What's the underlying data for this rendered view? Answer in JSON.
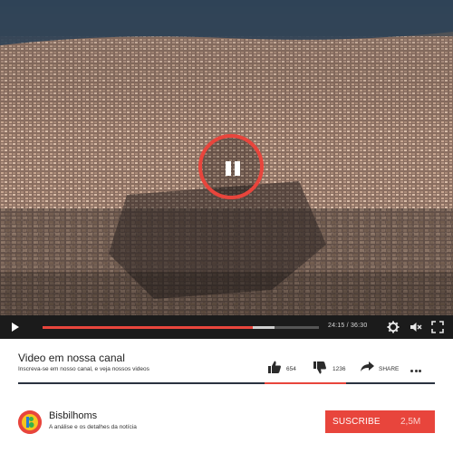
{
  "player": {
    "state": "playing",
    "current_time": "24:15",
    "total_time": "36:30",
    "played_fraction": 0.76,
    "loaded_fraction": 0.84,
    "time_display": "24:15 / 36:30"
  },
  "video": {
    "title": "Video em nossa canal",
    "subtitle": "Inscreva-se em nosso canal, e veja nossos videos"
  },
  "actions": {
    "likes": "654",
    "dislikes": "1236",
    "share_label": "SHARE"
  },
  "channel": {
    "name": "Bisbilhoms",
    "description": "A análise e os detalhes da notícia"
  },
  "subscribe": {
    "label": "SUSCRIBE",
    "count": "2,5M"
  },
  "colors": {
    "accent": "#e8453c",
    "control_bar": "#1b1b1b",
    "divider": "#2a3340"
  },
  "icons": [
    "pause-icon",
    "play-icon",
    "gear-icon",
    "volume-icon",
    "fullscreen-icon",
    "thumbs-up-icon",
    "thumbs-down-icon",
    "share-icon",
    "more-icon"
  ]
}
